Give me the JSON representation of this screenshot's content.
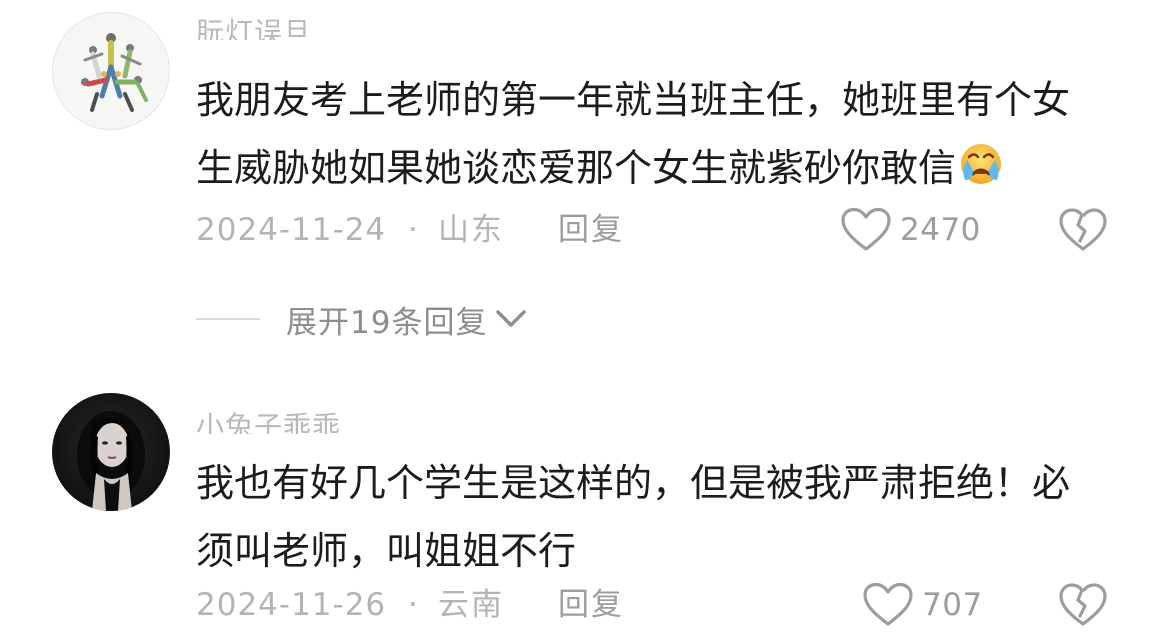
{
  "comments": [
    {
      "username": "朊灯误旦",
      "text_lines": [
        "我朋友考上老师的第一年就当班主任，她班里有个女",
        "生威胁她如果她谈恋爱那个女生就紫砂你敢信"
      ],
      "emoji_icon": "crying-face-icon",
      "date": "2024-11-24",
      "separator": "·",
      "location": "山东",
      "reply_label": "回复",
      "like_icon": "heart-outline-icon",
      "like_count": "2470",
      "dislike_icon": "broken-heart-icon",
      "expand_replies_label": "展开19条回复",
      "expand_icon": "chevron-down-icon"
    },
    {
      "username": "小兔子乖乖",
      "text_lines": [
        "我也有好几个学生是这样的，但是被我严肃拒绝！必",
        "须叫老师，叫姐姐不行"
      ],
      "date": "2024-11-26",
      "separator": "·",
      "location": "云南",
      "reply_label": "回复",
      "like_icon": "heart-outline-icon",
      "like_count": "707",
      "dislike_icon": "broken-heart-icon"
    }
  ],
  "colors": {
    "text_primary": "#1c1c1c",
    "text_meta": "#b4b4b4",
    "icon": "#9d9d9d",
    "background": "#ffffff"
  }
}
